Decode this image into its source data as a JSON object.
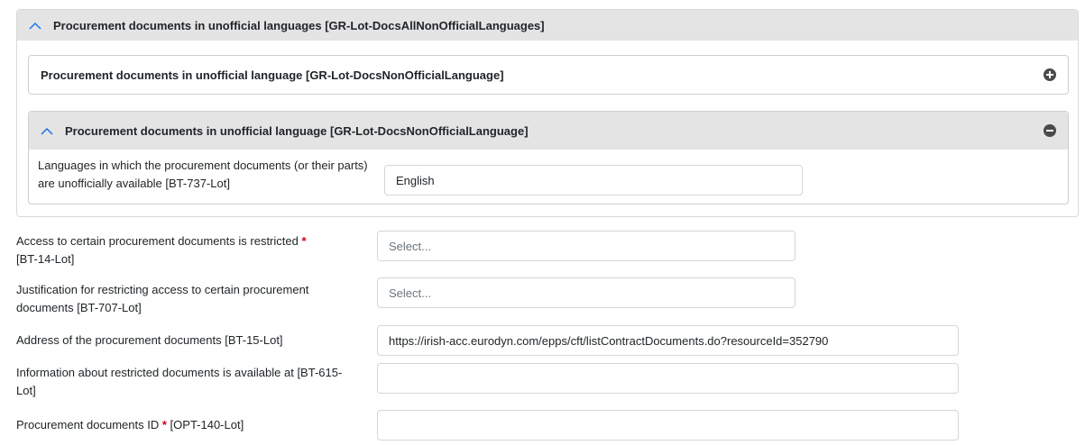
{
  "groups": {
    "outer_title": "Procurement documents in unofficial languages  [GR-Lot-DocsAllNonOfficialLanguages]",
    "collapsed_title": "Procurement documents in unofficial language  [GR-Lot-DocsNonOfficialLanguage]",
    "expanded_title": "Procurement documents in unofficial language  [GR-Lot-DocsNonOfficialLanguage]",
    "language_field": {
      "label": "Languages in which the procurement documents (or their parts) are unofficially available [BT-737-Lot]",
      "value": "English"
    }
  },
  "fields": {
    "access_restricted": {
      "label": "Access to certain procurement documents is restricted",
      "required": "*",
      "code": "[BT-14-Lot]",
      "placeholder": "Select..."
    },
    "justification": {
      "label": "Justification for restricting access to certain procurement documents [BT-707-Lot]",
      "placeholder": "Select..."
    },
    "address": {
      "label": "Address of the procurement documents [BT-15-Lot]",
      "value": "https://irish-acc.eurodyn.com/epps/cft/listContractDocuments.do?resourceId=352790"
    },
    "restricted_info": {
      "label": "Information about restricted documents is available at [BT-615-Lot]",
      "value": ""
    },
    "docs_id": {
      "label": "Procurement documents ID",
      "required": "*",
      "code": "[OPT-140-Lot]",
      "value": ""
    }
  },
  "colors": {
    "header_bg": "#e4e4e4",
    "accent_chevron": "#1a73e8",
    "required_star": "#d0021b"
  },
  "icons": {
    "collapse": "chevron-up-icon",
    "add": "plus-circle-icon",
    "remove": "minus-circle-icon"
  }
}
